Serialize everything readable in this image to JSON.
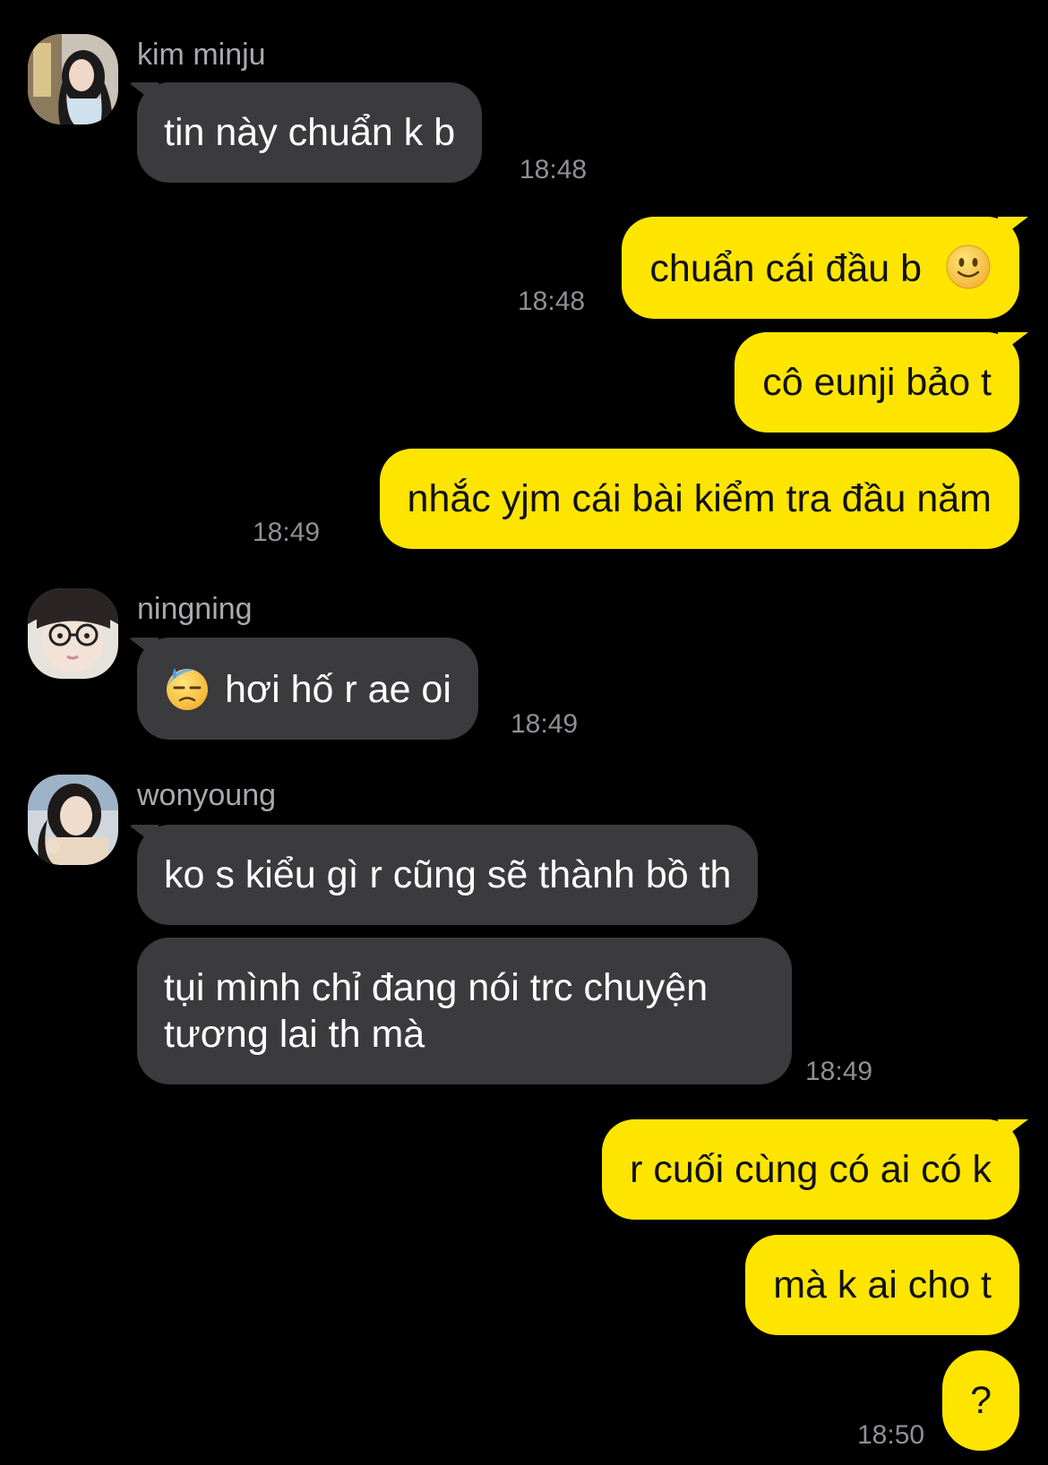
{
  "chat": {
    "colors": {
      "background": "#000000",
      "incoming_bubble": "#3b3b3e",
      "outgoing_bubble": "#fee500",
      "sender_name": "#a9a9ae",
      "timestamp": "#8f8f94"
    },
    "groups": [
      {
        "sender": "kim minju",
        "avatar_icon": "profile-photo-icon",
        "messages": [
          {
            "text": "tin này chuẩn k b"
          }
        ],
        "time": "18:48"
      },
      {
        "sender": "me",
        "messages": [
          {
            "text": "chuẩn cái đầu b",
            "emoji": "slightly-smiling-face-icon"
          }
        ],
        "time": "18:48"
      },
      {
        "sender": "me",
        "messages": [
          {
            "text": "cô eunji bảo t"
          },
          {
            "text": "nhắc yjm cái bài kiểm tra đầu năm"
          }
        ],
        "time": "18:49"
      },
      {
        "sender": "ningning",
        "avatar_icon": "profile-photo-icon",
        "messages": [
          {
            "text": "hơi hố r ae oi",
            "emoji": "downcast-face-with-sweat-icon"
          }
        ],
        "time": "18:49"
      },
      {
        "sender": "wonyoung",
        "avatar_icon": "profile-photo-icon",
        "messages": [
          {
            "text": "ko s kiểu gì r cũng sẽ thành bồ th"
          },
          {
            "text": "tụi mình chỉ đang nói trc chuyện tương lai th mà"
          }
        ],
        "time": "18:49"
      },
      {
        "sender": "me",
        "messages": [
          {
            "text": "r cuối cùng có ai có k"
          },
          {
            "text": "mà k ai cho t"
          },
          {
            "text": "?"
          }
        ],
        "time": "18:50"
      }
    ]
  }
}
